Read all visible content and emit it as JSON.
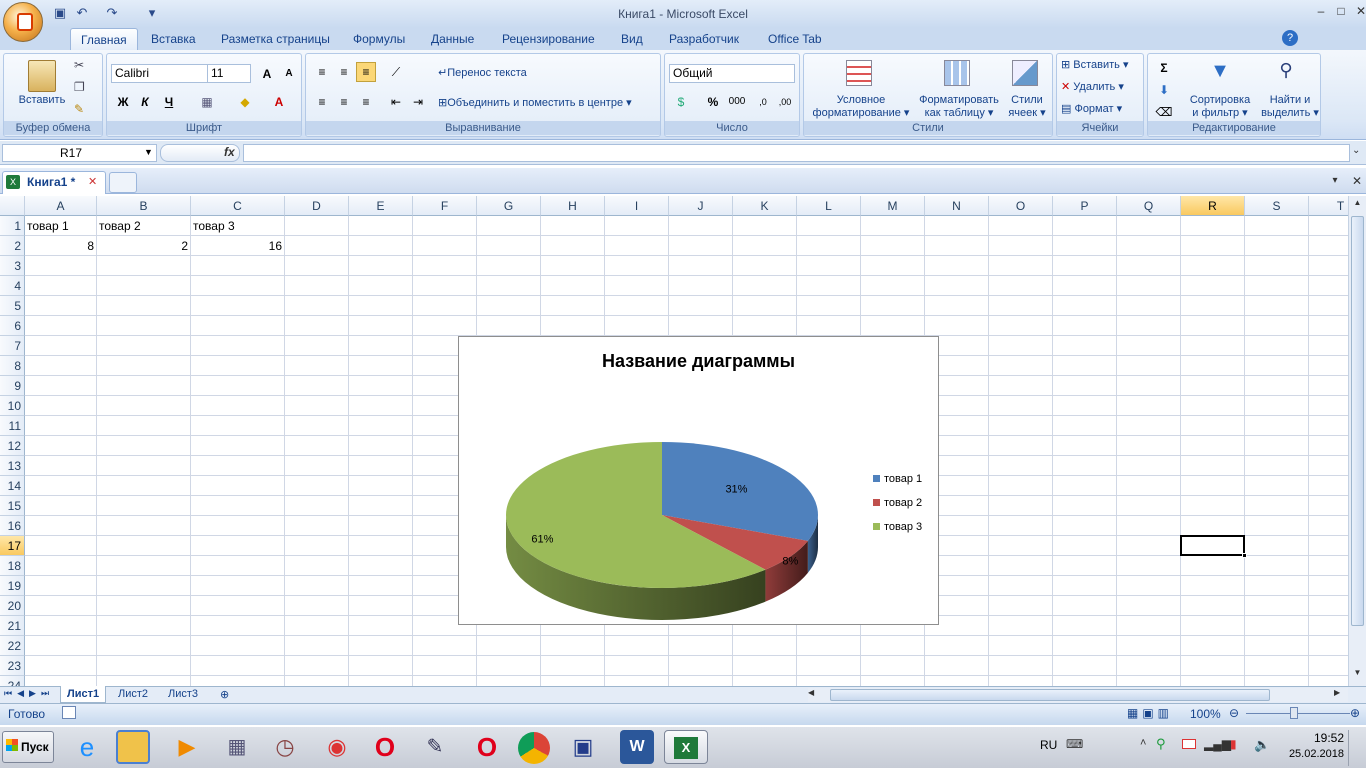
{
  "window": {
    "title": "Книга1 - Microsoft Excel"
  },
  "ribbon_tabs": [
    "Главная",
    "Вставка",
    "Разметка страницы",
    "Формулы",
    "Данные",
    "Рецензирование",
    "Вид",
    "Разработчик",
    "Office Tab"
  ],
  "groups": {
    "clipboard": {
      "label": "Буфер обмена",
      "paste": "Вставить"
    },
    "font": {
      "label": "Шрифт",
      "font_name": "Calibri",
      "font_size": "11",
      "bold": "Ж",
      "italic": "К",
      "underline": "Ч"
    },
    "alignment": {
      "label": "Выравнивание",
      "wrap": "Перенос текста",
      "merge": "Объединить и поместить в центре"
    },
    "number": {
      "label": "Число",
      "format": "Общий",
      "percent": "%",
      "thousands": "000"
    },
    "styles": {
      "label": "Стили",
      "conditional_1": "Условное",
      "conditional_2": "форматирование",
      "as_table_1": "Форматировать",
      "as_table_2": "как таблицу",
      "cell_styles_1": "Стили",
      "cell_styles_2": "ячеек"
    },
    "cells": {
      "label": "Ячейки",
      "insert": "Вставить",
      "delete": "Удалить",
      "format": "Формат"
    },
    "editing": {
      "label": "Редактирование",
      "sort_1": "Сортировка",
      "sort_2": "и фильтр",
      "find_1": "Найти и",
      "find_2": "выделить"
    }
  },
  "formula_bar": {
    "name_box": "R17",
    "fx": "fx",
    "formula": ""
  },
  "doc_tab": {
    "name": "Книга1 *"
  },
  "columns": [
    "A",
    "B",
    "C",
    "D",
    "E",
    "F",
    "G",
    "H",
    "I",
    "J",
    "K",
    "L",
    "M",
    "N",
    "O",
    "P",
    "Q",
    "R",
    "S",
    "T"
  ],
  "rows": [
    "1",
    "2",
    "3",
    "4",
    "5",
    "6",
    "7",
    "8",
    "9",
    "10",
    "11",
    "12",
    "13",
    "14",
    "15",
    "16",
    "17",
    "18",
    "19",
    "20",
    "21",
    "22",
    "23",
    "24"
  ],
  "selected_cell": {
    "col": "R",
    "row": "17"
  },
  "cells": {
    "A1": "товар 1",
    "B1": "товар 2",
    "C1": "товар 3",
    "A2": "8",
    "B2": "2",
    "C2": "16"
  },
  "sheets": [
    "Лист1",
    "Лист2",
    "Лист3"
  ],
  "active_sheet": "Лист1",
  "status": {
    "ready": "Готово",
    "zoom": "100%"
  },
  "taskbar": {
    "start": "Пуск",
    "lang": "RU",
    "time": "19:52",
    "date": "25.02.2018"
  },
  "colors": {
    "accent": "#15428b",
    "series": [
      "#4f81bd",
      "#c0504d",
      "#9bbb59"
    ]
  },
  "chart_data": {
    "type": "pie",
    "title": "Название диаграммы",
    "categories": [
      "товар 1",
      "товар 2",
      "товар 3"
    ],
    "values": [
      8,
      2,
      16
    ],
    "data_labels": [
      "31%",
      "8%",
      "61%"
    ],
    "legend": "right",
    "three_d": true
  }
}
